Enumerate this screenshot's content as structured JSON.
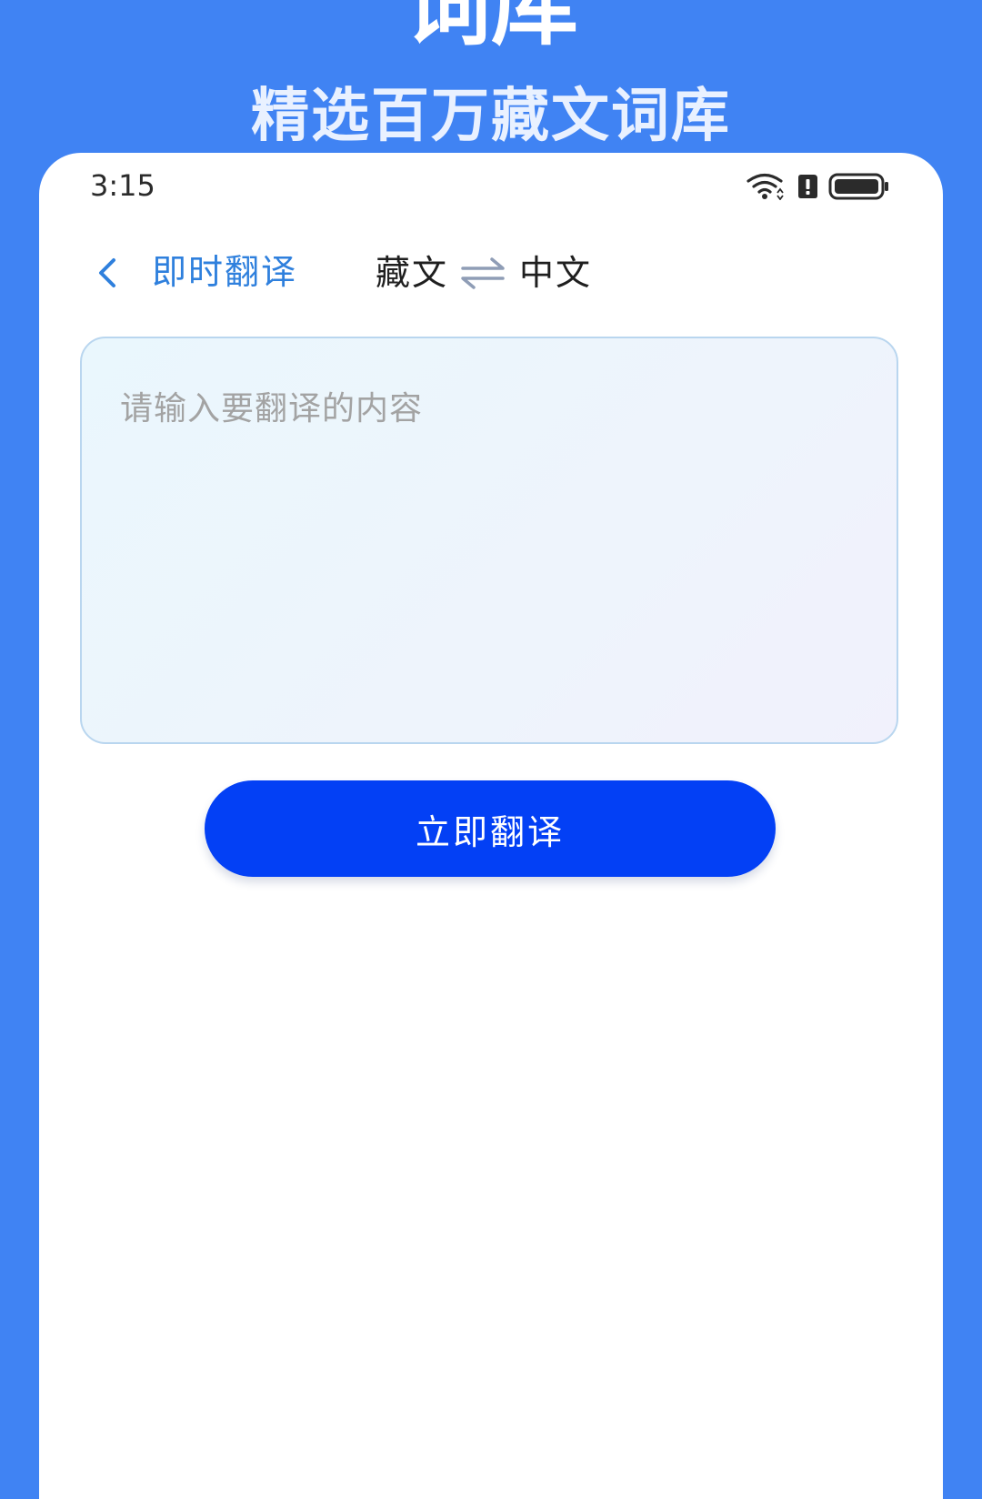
{
  "promo": {
    "title": "词库",
    "subtitle": "精选百万藏文词库"
  },
  "status_bar": {
    "time": "3:15",
    "icons": [
      "wifi-icon",
      "sim-alert-icon",
      "battery-icon"
    ]
  },
  "nav": {
    "back_icon": "chevron-left-icon",
    "title": "即时翻译",
    "source_lang": "藏文",
    "swap_icon": "swap-arrows-icon",
    "target_lang": "中文"
  },
  "input": {
    "placeholder": "请输入要翻译的内容",
    "value": ""
  },
  "actions": {
    "translate_label": "立即翻译"
  },
  "colors": {
    "background": "#4083f3",
    "accent": "#0340f5",
    "title_blue": "#2f80dd",
    "input_border": "#b9d6ef"
  }
}
